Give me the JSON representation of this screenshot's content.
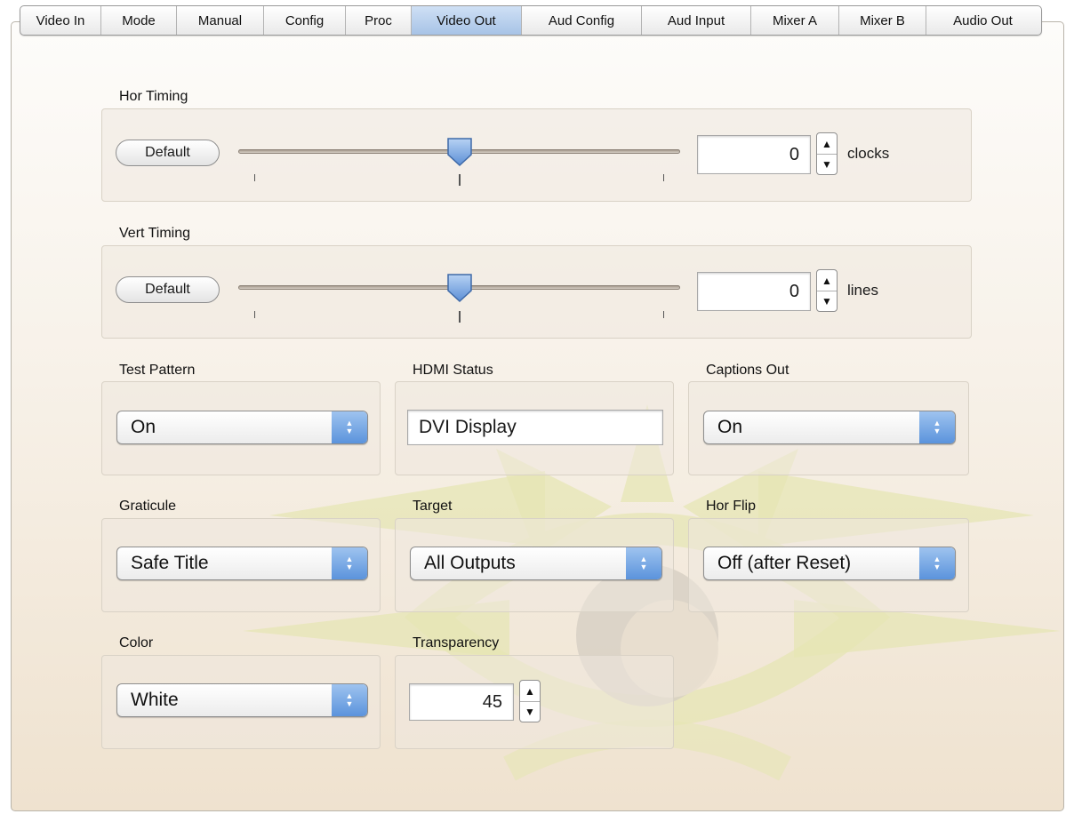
{
  "tabs": [
    {
      "label": "Video In",
      "active": false
    },
    {
      "label": "Mode",
      "active": false
    },
    {
      "label": "Manual",
      "active": false
    },
    {
      "label": "Config",
      "active": false
    },
    {
      "label": "Proc",
      "active": false
    },
    {
      "label": "Video Out",
      "active": true
    },
    {
      "label": "Aud Config",
      "active": false
    },
    {
      "label": "Aud Input",
      "active": false
    },
    {
      "label": "Mixer A",
      "active": false
    },
    {
      "label": "Mixer B",
      "active": false
    },
    {
      "label": "Audio Out",
      "active": false
    }
  ],
  "hor_timing": {
    "title": "Hor Timing",
    "button": "Default",
    "value": "0",
    "unit": "clocks",
    "slider_fraction": 0.5
  },
  "vert_timing": {
    "title": "Vert Timing",
    "button": "Default",
    "value": "0",
    "unit": "lines",
    "slider_fraction": 0.5
  },
  "test_pattern": {
    "title": "Test Pattern",
    "value": "On"
  },
  "hdmi_status": {
    "title": "HDMI Status",
    "value": "DVI Display"
  },
  "captions_out": {
    "title": "Captions Out",
    "value": "On"
  },
  "graticule": {
    "title": "Graticule",
    "value": "Safe Title"
  },
  "target": {
    "title": "Target",
    "value": "All Outputs"
  },
  "hor_flip": {
    "title": "Hor Flip",
    "value": "Off (after Reset)"
  },
  "color": {
    "title": "Color",
    "value": "White"
  },
  "transparency": {
    "title": "Transparency",
    "value": "45"
  },
  "colors": {
    "accent": "#6b9fe0",
    "active_tab": "#b7cfec",
    "watermark": "#e4e4b0"
  },
  "icons": {
    "step_up": "▲",
    "step_down": "▼",
    "popup_up": "▲",
    "popup_down": "▼"
  }
}
